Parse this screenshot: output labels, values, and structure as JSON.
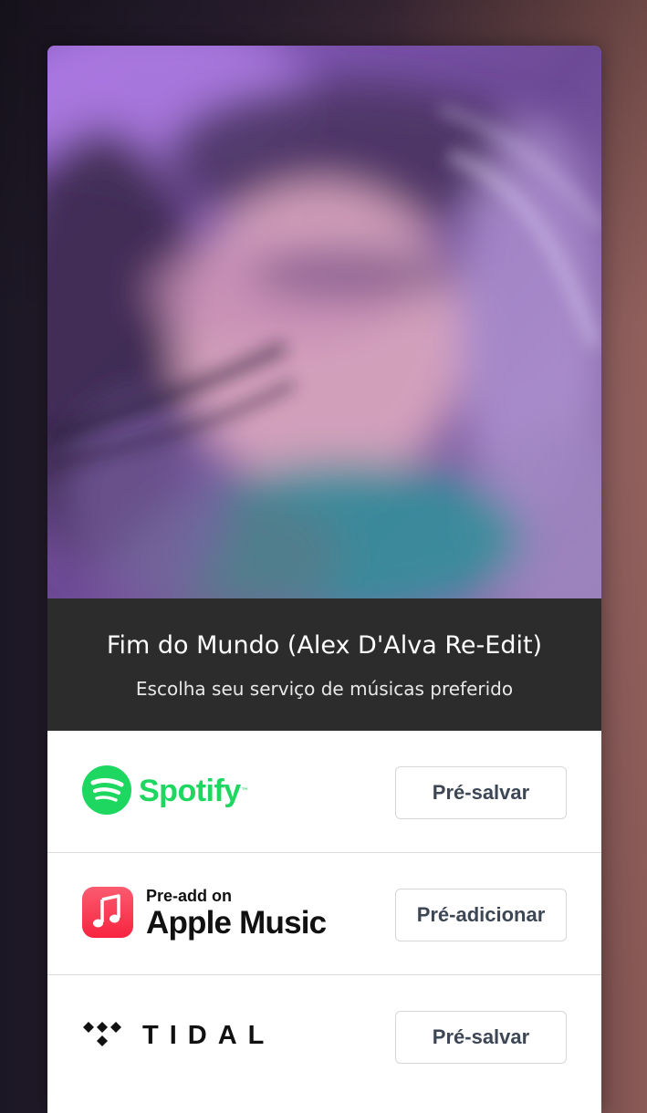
{
  "release": {
    "title": "Fim do Mundo (Alex D'Alva Re-Edit)",
    "subtitle": "Escolha seu serviço de músicas preferido"
  },
  "cover": {
    "icon": "album-cover-image",
    "colors": {
      "base": "#6a4b8f",
      "highlight": "#a774d6",
      "skin": "#d9a0b7",
      "teal": "#2f8f99"
    }
  },
  "services": [
    {
      "name": "Spotify",
      "logo_text": "Spotify",
      "trademark": "™",
      "icon": "spotify-icon",
      "button": "Pré-salvar",
      "color": "#1ed760"
    },
    {
      "name": "Apple Music",
      "logo_small": "Pre-add on",
      "logo_big": "Apple Music",
      "icon": "apple-music-icon",
      "button": "Pré-adicionar",
      "color": "#fa2d48"
    },
    {
      "name": "TIDAL",
      "logo_text": "TIDAL",
      "icon": "tidal-icon",
      "button": "Pré-salvar",
      "color": "#111111"
    }
  ],
  "colors": {
    "header_bg": "#2c2c2c",
    "button_text": "#3d4654",
    "button_border": "#d4d6da"
  }
}
